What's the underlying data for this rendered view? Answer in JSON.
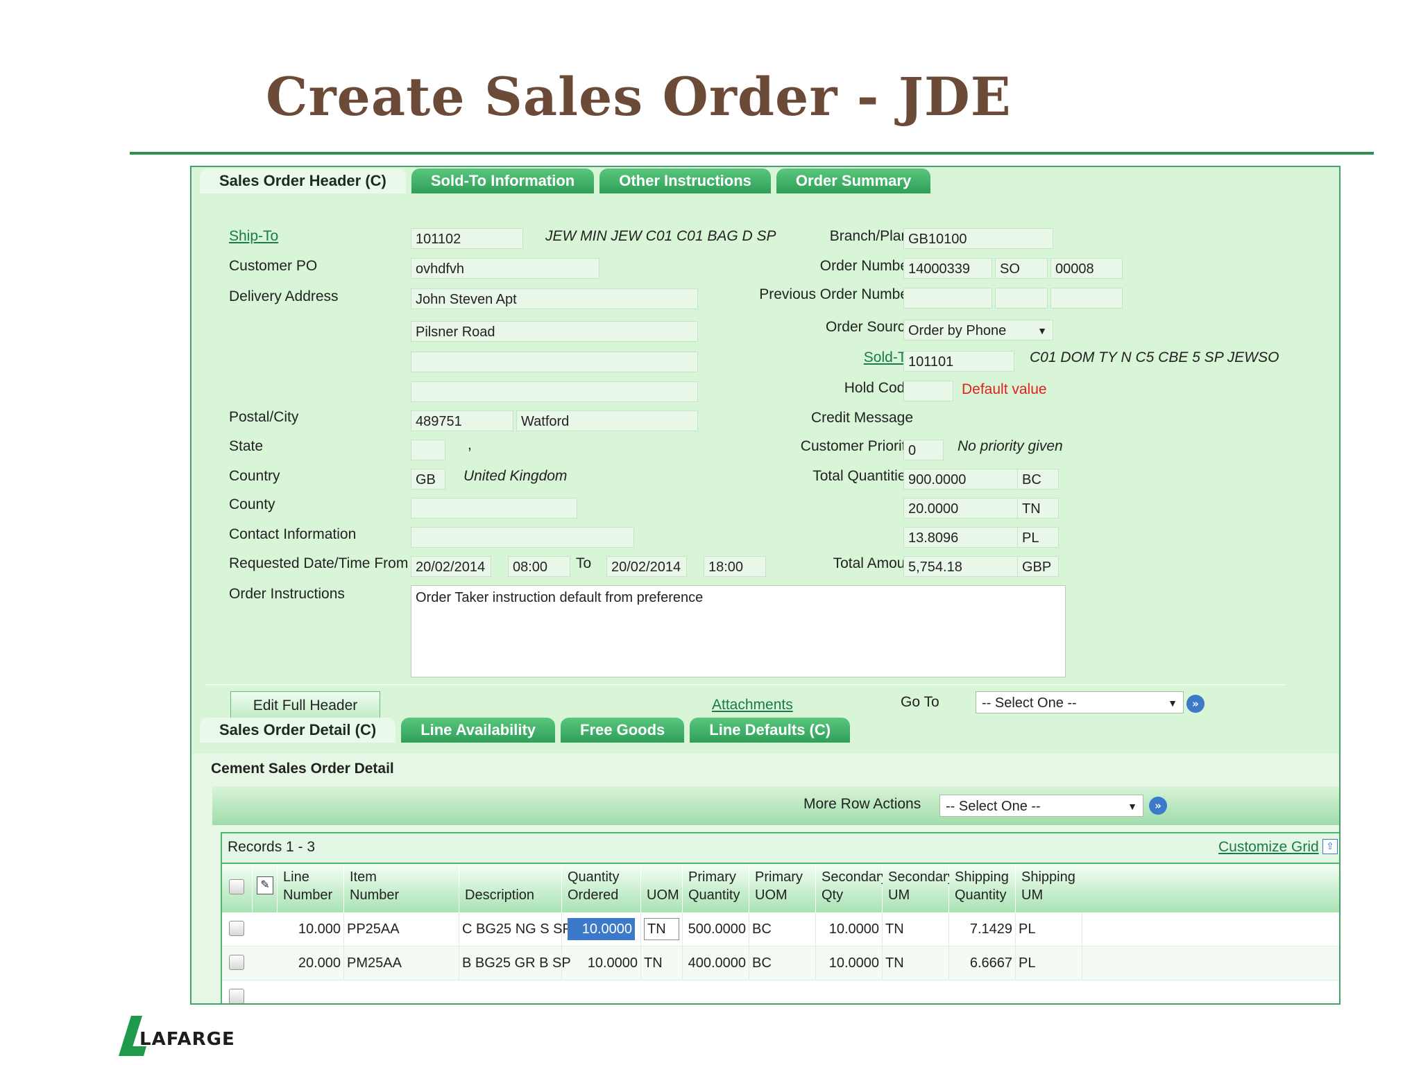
{
  "slide": {
    "title": "Create Sales Order - JDE",
    "brand": "LAFARGE"
  },
  "header_tabs": [
    "Sales Order Header (C)",
    "Sold-To Information",
    "Other Instructions",
    "Order Summary"
  ],
  "left": {
    "ship_to_label": "Ship-To",
    "ship_to": "101102",
    "ship_to_desc": "JEW MIN JEW C01 C01 BAG D SP",
    "customer_po_label": "Customer PO",
    "customer_po": "ovhdfvh",
    "delivery_address_label": "Delivery Address",
    "addr1": "John Steven Apt",
    "addr2": "Pilsner Road",
    "postal_city_label": "Postal/City",
    "postal": "489751",
    "city": "Watford",
    "state_label": "State",
    "state_desc": ",",
    "country_label": "Country",
    "country": "GB",
    "country_desc": "United Kingdom",
    "county_label": "County",
    "contact_label": "Contact Information",
    "req_label": "Requested Date/Time From",
    "req_date_from": "20/02/2014",
    "req_time_from": "08:00",
    "to_label": "To",
    "req_date_to": "20/02/2014",
    "req_time_to": "18:00",
    "instructions_label": "Order Instructions",
    "instructions": "Order Taker instruction default from preference"
  },
  "right": {
    "branch_label": "Branch/Plant",
    "branch": "GB10100",
    "order_number_label": "Order Number",
    "order_number": "14000339",
    "order_type": "SO",
    "order_co": "00008",
    "prev_order_label": "Previous Order Number",
    "order_source_label": "Order Source",
    "order_source": "Order by Phone",
    "sold_to_label": "Sold-To",
    "sold_to": "101101",
    "sold_to_desc": "C01 DOM TY N C5 CBE 5 SP JEWSO",
    "hold_code_label": "Hold Code",
    "hold_default": "Default value",
    "credit_label": "Credit Message",
    "priority_label": "Customer Priority",
    "priority": "0",
    "priority_desc": "No priority given",
    "totals_label": "Total Quantities",
    "totals": [
      {
        "qty": "900.0000",
        "uom": "BC"
      },
      {
        "qty": "20.0000",
        "uom": "TN"
      },
      {
        "qty": "13.8096",
        "uom": "PL"
      }
    ],
    "amount_label": "Total Amount",
    "amount": "5,754.18",
    "currency": "GBP"
  },
  "actions": {
    "edit_header": "Edit Full Header",
    "attachments": "Attachments",
    "goto_label": "Go To",
    "goto_select": "-- Select One --"
  },
  "detail_tabs": [
    "Sales Order Detail (C)",
    "Line Availability",
    "Free Goods",
    "Line Defaults (C)"
  ],
  "detail": {
    "section_title": "Cement Sales Order Detail",
    "more_actions_label": "More Row Actions",
    "more_actions_select": "-- Select One --",
    "records": "Records 1 - 3",
    "customize": "Customize Grid",
    "columns": [
      [
        "Line",
        "Number"
      ],
      [
        "Item",
        "Number"
      ],
      [
        "",
        "Description"
      ],
      [
        "Quantity",
        "Ordered"
      ],
      [
        "",
        "UOM"
      ],
      [
        "Primary",
        "Quantity"
      ],
      [
        "Primary",
        "UOM"
      ],
      [
        "Secondary",
        "Qty"
      ],
      [
        "Secondary",
        "UM"
      ],
      [
        "Shipping",
        "Quantity"
      ],
      [
        "Shipping",
        "UM"
      ]
    ],
    "rows": [
      [
        "10.000",
        "PP25AA",
        "C BG25 NG S SP",
        "10.0000",
        "TN",
        "500.0000",
        "BC",
        "10.0000",
        "TN",
        "7.1429",
        "PL"
      ],
      [
        "20.000",
        "PM25AA",
        "B BG25 GR B SP",
        "10.0000",
        "TN",
        "400.0000",
        "BC",
        "10.0000",
        "TN",
        "6.6667",
        "PL"
      ]
    ]
  }
}
